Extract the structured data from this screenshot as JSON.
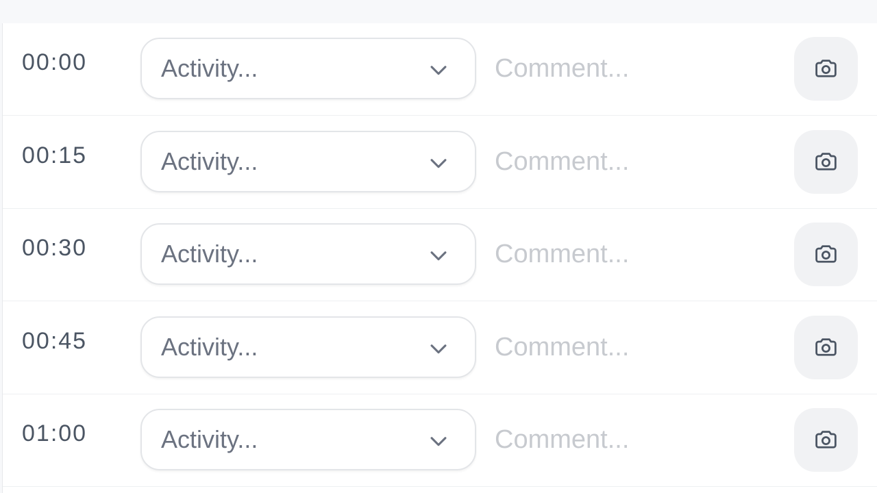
{
  "rows": [
    {
      "time": "00:00",
      "activity_label": "Activity...",
      "comment_placeholder": "Comment...",
      "comment_value": ""
    },
    {
      "time": "00:15",
      "activity_label": "Activity...",
      "comment_placeholder": "Comment...",
      "comment_value": ""
    },
    {
      "time": "00:30",
      "activity_label": "Activity...",
      "comment_placeholder": "Comment...",
      "comment_value": ""
    },
    {
      "time": "00:45",
      "activity_label": "Activity...",
      "comment_placeholder": "Comment...",
      "comment_value": ""
    },
    {
      "time": "01:00",
      "activity_label": "Activity...",
      "comment_placeholder": "Comment...",
      "comment_value": ""
    }
  ],
  "icons": {
    "select": "chevron-down-icon",
    "photo": "camera-icon"
  },
  "colors": {
    "time_text": "#4b5563",
    "placeholder": "#c7cacf",
    "camera_button_bg": "#f1f2f4"
  }
}
